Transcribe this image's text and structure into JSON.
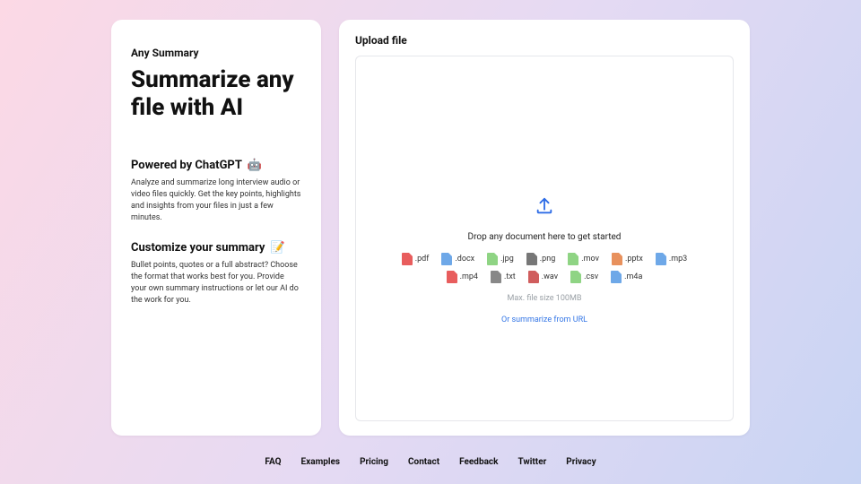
{
  "brand": "Any Summary",
  "hero_title": "Summarize any file with AI",
  "sections": [
    {
      "heading": "Powered by ChatGPT",
      "emoji": "🤖",
      "body": "Analyze and summarize long interview audio or video files quickly. Get the key points, highlights and insights from your files in just a few minutes."
    },
    {
      "heading": "Customize your summary",
      "emoji": "📝",
      "body": "Bullet points, quotes or a full abstract? Choose the format that works best for you. Provide your own summary instructions or let our AI do the work for you."
    }
  ],
  "upload": {
    "label": "Upload file",
    "drop_text": "Drop any document here to get started",
    "max_size": "Max. file size 100MB",
    "url_link": "Or summarize from URL",
    "formats": [
      {
        "ext": ".pdf",
        "icon": "pdf"
      },
      {
        "ext": ".docx",
        "icon": "docx"
      },
      {
        "ext": ".jpg",
        "icon": "jpg"
      },
      {
        "ext": ".png",
        "icon": "png"
      },
      {
        "ext": ".mov",
        "icon": "mov"
      },
      {
        "ext": ".pptx",
        "icon": "pptx"
      },
      {
        "ext": ".mp3",
        "icon": "mp3"
      },
      {
        "ext": ".mp4",
        "icon": "mp4"
      },
      {
        "ext": ".txt",
        "icon": "txt"
      },
      {
        "ext": ".wav",
        "icon": "wav"
      },
      {
        "ext": ".csv",
        "icon": "csv"
      },
      {
        "ext": ".m4a",
        "icon": "m4a"
      }
    ]
  },
  "footer": [
    "FAQ",
    "Examples",
    "Pricing",
    "Contact",
    "Feedback",
    "Twitter",
    "Privacy"
  ]
}
